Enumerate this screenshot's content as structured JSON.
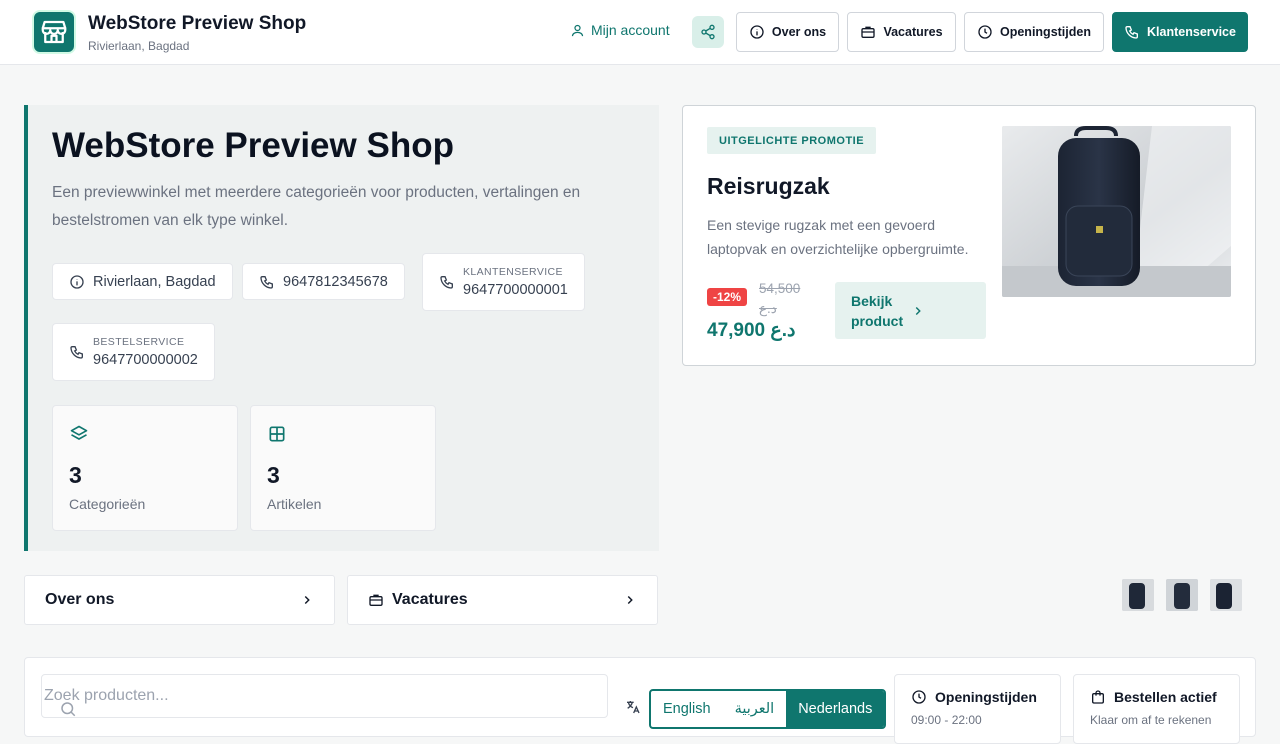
{
  "header": {
    "shop_name": "WebStore Preview Shop",
    "location": "Rivierlaan, Bagdad",
    "account_label": "Mijn account",
    "nav": {
      "about": "Over ons",
      "jobs": "Vacatures",
      "hours": "Openingstijden",
      "support": "Klantenservice"
    }
  },
  "hero": {
    "title": "WebStore Preview Shop",
    "description": "Een previewwinkel met meerdere categorieën voor producten, vertalingen en bestelstromen van elk type winkel.",
    "address": "Rivierlaan, Bagdad",
    "phone": "9647812345678",
    "customer_service": {
      "label": "KLANTENSERVICE",
      "value": "9647700000001"
    },
    "order_service": {
      "label": "BESTELSERVICE",
      "value": "9647700000002"
    },
    "stats": [
      {
        "value": "3",
        "label": "Categorieën"
      },
      {
        "value": "3",
        "label": "Artikelen"
      }
    ]
  },
  "promo": {
    "badge": "UITGELICHTE PROMOTIE",
    "title": "Reisrugzak",
    "description": "Een stevige rugzak met een gevoerd laptopvak en overzichtelijke opbergruimte.",
    "discount": "-12%",
    "old_price": "54,500 د.ع",
    "price": "47,900 د.ع",
    "cta": "Bekijk product"
  },
  "links": {
    "about": "Over ons",
    "jobs": "Vacatures"
  },
  "bottom": {
    "search_placeholder": "Zoek producten...",
    "languages": [
      "English",
      "العربية",
      "Nederlands"
    ],
    "active_language": "Nederlands",
    "hours": {
      "title": "Openingstijden",
      "value": "09:00 - 22:00"
    },
    "ordering": {
      "title": "Bestellen actief",
      "value": "Klaar om af te rekenen"
    }
  },
  "colors": {
    "accent": "#0f766e",
    "discount": "#ef4444"
  },
  "icons": [
    "store-icon",
    "user-icon",
    "share-icon",
    "info-icon",
    "briefcase-icon",
    "clock-icon",
    "phone-icon",
    "layers-icon",
    "grid-icon",
    "chevron-right-icon",
    "search-icon",
    "translate-icon",
    "shopping-bag-icon"
  ]
}
